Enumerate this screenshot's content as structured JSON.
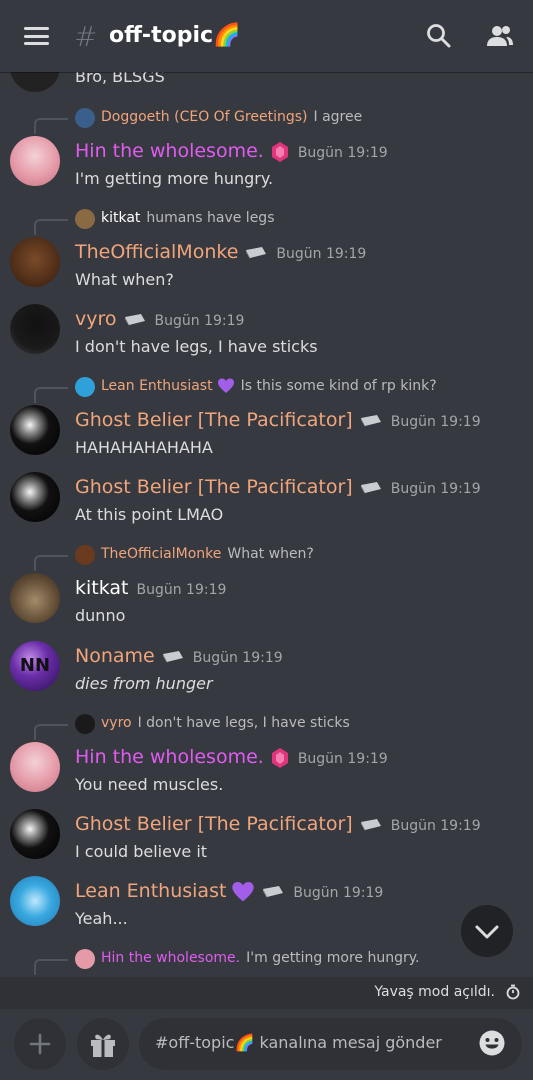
{
  "header": {
    "channel_name": "off-topic",
    "channel_emoji": "🌈",
    "hash": "#"
  },
  "colors": {
    "orange": "#f0a57c",
    "pink": "#e05cf0",
    "white": "#ffffff",
    "timestamp": "#a3a6aa",
    "background": "#36393f"
  },
  "messages": {
    "m0": {
      "body": "Bro, BLSGS"
    },
    "r1": {
      "name": "Doggoeth (CEO Of Greetings)",
      "text": "I agree"
    },
    "m1": {
      "name": "Hin the wholesome.",
      "ts": "Bugün 19:19",
      "body": "I'm getting more hungry."
    },
    "r2": {
      "name": "kitkat",
      "text": "humans have legs"
    },
    "m2": {
      "name": "TheOfficialMonke",
      "ts": "Bugün 19:19",
      "body": "What when?"
    },
    "m3": {
      "name": "vyro",
      "ts": "Bugün 19:19",
      "body": "I don't have legs, I have sticks"
    },
    "r3": {
      "name": "Lean Enthusiast",
      "text": "Is this some kind of rp kink?"
    },
    "m4": {
      "name": "Ghost Belier [The Pacificator]",
      "ts": "Bugün 19:19",
      "body": "HAHAHAHAHAHA"
    },
    "m5": {
      "name": "Ghost Belier [The Pacificator]",
      "ts": "Bugün 19:19",
      "body": "At this point LMAO"
    },
    "r4": {
      "name": "TheOfficialMonke",
      "text": "What when?"
    },
    "m6": {
      "name": "kitkat",
      "ts": "Bugün 19:19",
      "body": "dunno"
    },
    "m7": {
      "name": "Noname",
      "ts": "Bugün 19:19",
      "body": "dies from hunger"
    },
    "r5": {
      "name": "vyro",
      "text": "I don't have legs, I have sticks"
    },
    "m8": {
      "name": "Hin the wholesome.",
      "ts": "Bugün 19:19",
      "body": "You need muscles."
    },
    "m9": {
      "name": "Ghost Belier [The Pacificator]",
      "ts": "Bugün 19:19",
      "body": "I could believe it"
    },
    "m10": {
      "name": "Lean Enthusiast",
      "ts": "Bugün 19:19",
      "body": "Yeah..."
    },
    "r6": {
      "name": "Hin the wholesome.",
      "text": "I'm getting more hungry."
    }
  },
  "slowmode": {
    "text": "Yavaş mod açıldı."
  },
  "composer": {
    "placeholder": "#off-topic🌈 kanalına mesaj gönder"
  },
  "avatars": {
    "noname_initials": "NN"
  },
  "icons": [
    "hamburger-icon",
    "hash-icon",
    "search-icon",
    "members-icon",
    "boost-gem-icon",
    "hypesquad-badge-icon",
    "purple-heart-icon",
    "chevron-down-icon",
    "timer-icon",
    "plus-icon",
    "gift-icon",
    "emoji-icon"
  ]
}
